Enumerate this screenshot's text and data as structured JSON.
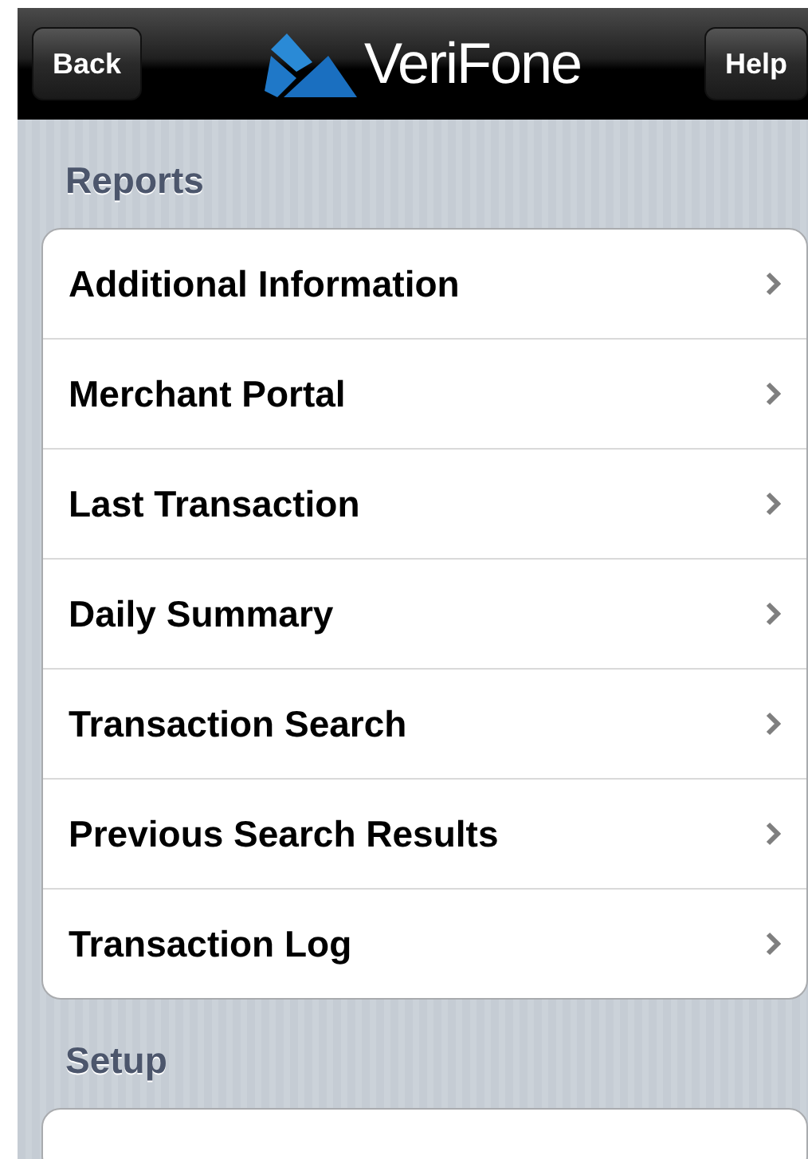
{
  "nav_bar": {
    "back_button": "Back",
    "logo_text": "VeriFone",
    "help_button": "Help"
  },
  "sections": [
    {
      "title": "Reports",
      "items": [
        {
          "label": "Additional Information"
        },
        {
          "label": "Merchant Portal"
        },
        {
          "label": "Last Transaction"
        },
        {
          "label": "Daily Summary"
        },
        {
          "label": "Transaction Search"
        },
        {
          "label": "Previous Search Results"
        },
        {
          "label": "Transaction Log"
        }
      ]
    },
    {
      "title": "Setup"
    }
  ]
}
